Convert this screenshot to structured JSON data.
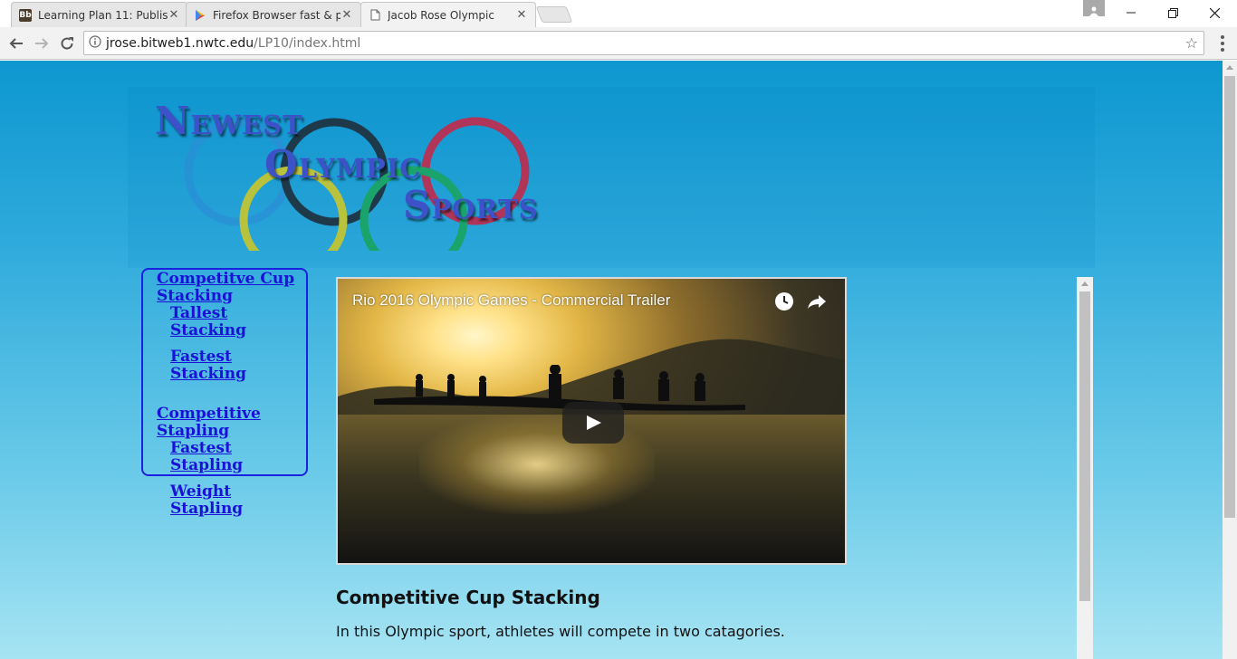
{
  "browser": {
    "tabs": [
      {
        "title": "Learning Plan 11: Publish",
        "favicon": "bb-icon",
        "active": false
      },
      {
        "title": "Firefox Browser fast & pr",
        "favicon": "play-store-icon",
        "active": false
      },
      {
        "title": "Jacob Rose Olympic",
        "favicon": "page-icon",
        "active": true
      }
    ],
    "url_host": "jrose.bitweb1.nwtc.edu",
    "url_path": "/LP10/index.html"
  },
  "logo": {
    "line1": "Newest",
    "line2": "Olympic",
    "line3": "Sports",
    "ring_colors": [
      "#2a8fd6",
      "#1e3a4a",
      "#b03558",
      "#b9c23c",
      "#1aa36b"
    ]
  },
  "sidebar": {
    "items": [
      {
        "label": "Competitve Cup Stacking",
        "level": 1
      },
      {
        "label": "Tallest Stacking",
        "level": 2
      },
      {
        "label": "Fastest Stacking",
        "level": 2
      },
      {
        "label": "Competitive Stapling",
        "level": 1
      },
      {
        "label": "Fastest Stapling",
        "level": 2
      },
      {
        "label": "Weight Stapling",
        "level": 2
      }
    ]
  },
  "main": {
    "video_title": "Rio 2016 Olympic Games - Commercial Trailer",
    "heading": "Competitive Cup Stacking",
    "paragraph": "In this Olympic sport, athletes will compete in two catagories."
  },
  "colors": {
    "link": "#1a10d8",
    "sidebar_border": "#1a22e0",
    "page_top": "#0d97d0",
    "page_bottom": "#a6e4f3"
  }
}
